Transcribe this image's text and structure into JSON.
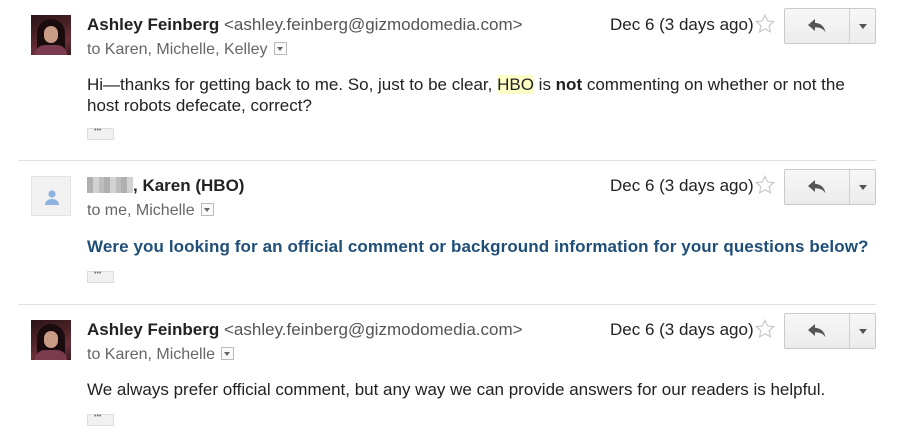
{
  "messages": [
    {
      "sender_name": "Ashley Feinberg",
      "sender_email": "<ashley.feinberg@gizmodomedia.com>",
      "recipients": "to Karen, Michelle, Kelley",
      "date": "Dec 6 (3 days ago)",
      "body_part1": "Hi—thanks for getting back to me.  So, just to be clear, ",
      "body_highlight": "HBO",
      "body_part2": " is ",
      "body_bold": "not",
      "body_part3": " commenting on whether or not the host robots defecate, correct?"
    },
    {
      "sender_name": ", Karen (HBO)",
      "recipients": "to me, Michelle",
      "date": "Dec 6 (3 days ago)",
      "body": "Were you looking for an official comment or background information for your questions below?"
    },
    {
      "sender_name": "Ashley Feinberg",
      "sender_email": "<ashley.feinberg@gizmodomedia.com>",
      "recipients": "to Karen, Michelle",
      "date": "Dec 6 (3 days ago)",
      "body": "We always prefer official comment, but any way we can provide answers for our readers is helpful."
    }
  ],
  "icons": {
    "star": "star-outline-icon",
    "reply": "reply-arrow-icon",
    "more": "dropdown-arrow-icon",
    "avatar_default": "person-icon"
  },
  "colors": {
    "highlight": "#ffffc8",
    "official_text": "#1f4e79",
    "separator": "#e0e0e0"
  }
}
